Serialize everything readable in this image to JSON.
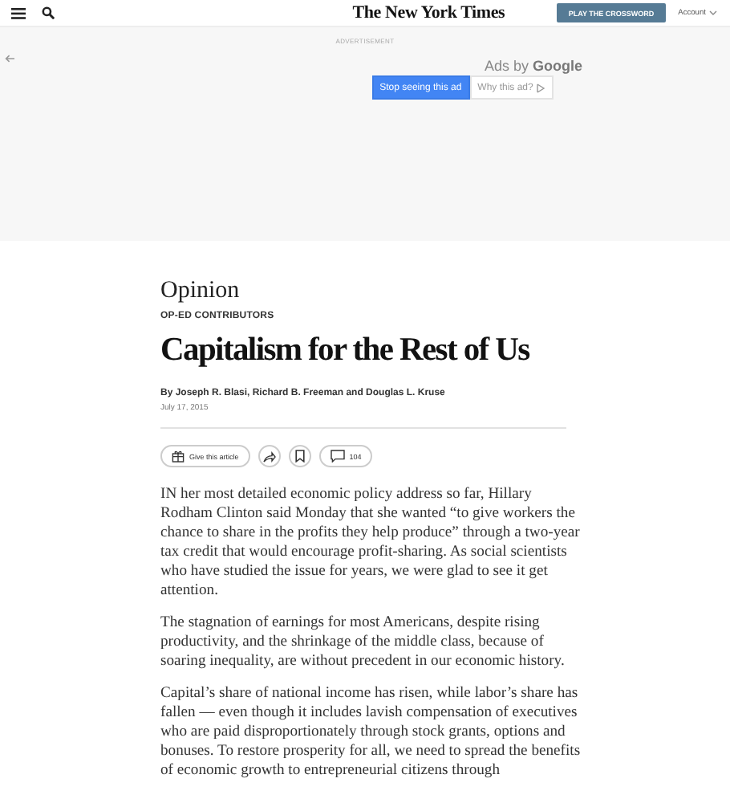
{
  "header": {
    "logo": "The New York Times",
    "crossword_button": "PLAY THE CROSSWORD",
    "account": "Account"
  },
  "ad": {
    "label": "ADVERTISEMENT",
    "ads_by": "Ads by",
    "brand": "Google",
    "stop_button": "Stop seeing this ad",
    "why_button": "Why this ad?"
  },
  "article": {
    "section": "Opinion",
    "kicker": "OP-ED CONTRIBUTORS",
    "title": "Capitalism for the Rest of Us",
    "byline": "By Joseph R. Blasi, Richard B. Freeman and Douglas L. Kruse",
    "date": "July 17, 2015",
    "actions": {
      "gift": "Give this article",
      "comments": "104"
    },
    "paragraphs": [
      "IN her most detailed economic policy address so far, Hillary Rodham Clinton said Monday that she wanted “to give workers the chance to share in the profits they help produce” through a two-year tax credit that would encourage profit-sharing. As social scientists who have studied the issue for years, we were glad to see it get attention.",
      "The stagnation of earnings for most Americans, despite rising productivity, and the shrinkage of the middle class, because of soaring inequality, are without precedent in our economic history.",
      "Capital’s share of national income has risen, while labor’s share has fallen — even though it includes lavish compensation of executives who are paid disproportionately through stock grants, options and bonuses. To restore prosperity for all, we need to spread the benefits of economic growth to entrepreneurial citizens through"
    ]
  }
}
